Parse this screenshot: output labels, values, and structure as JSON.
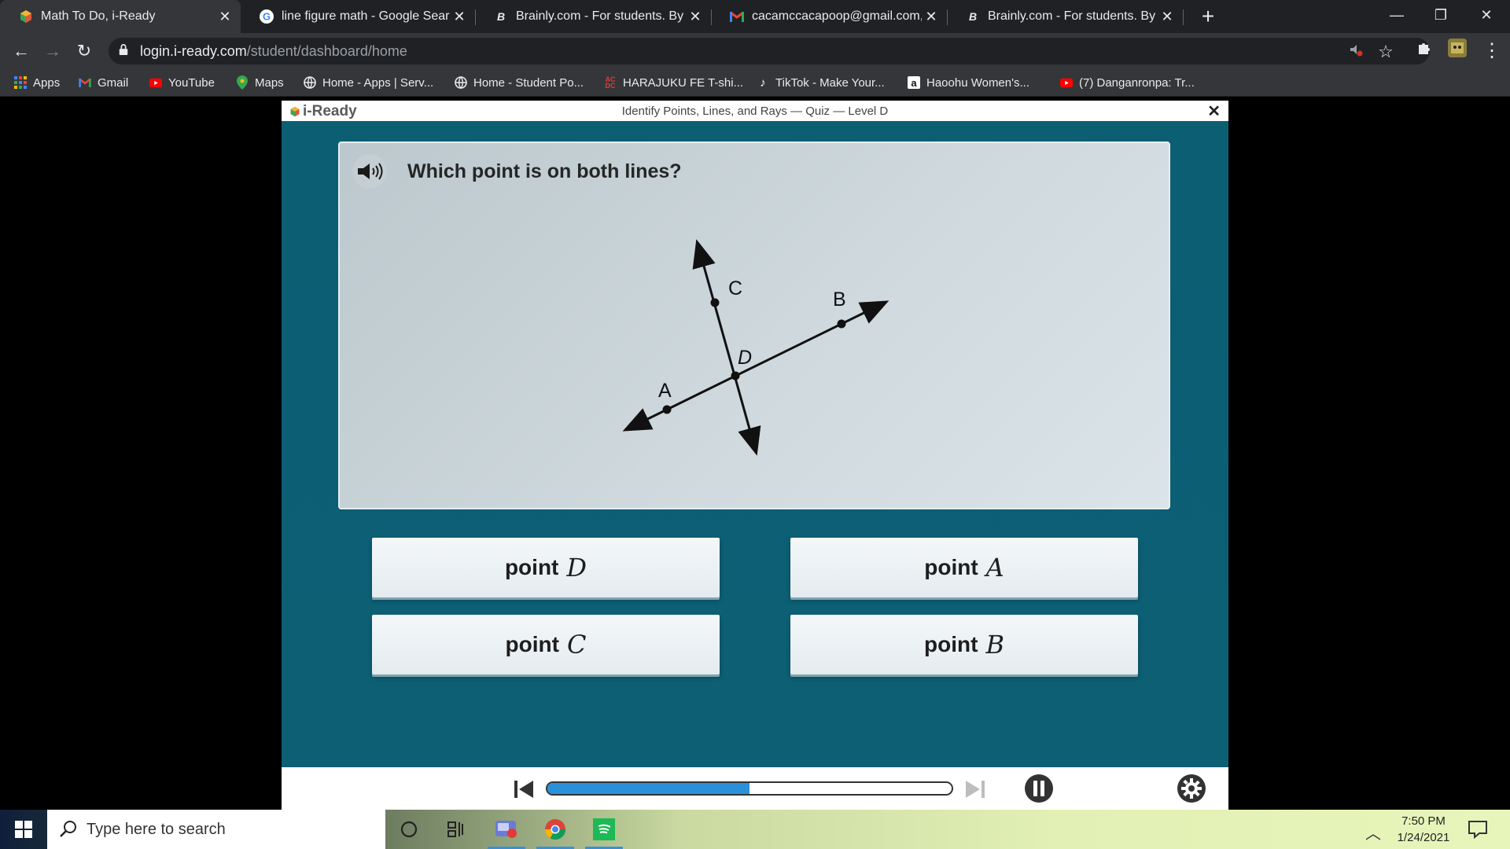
{
  "browser": {
    "tabs": [
      {
        "title": "Math To Do, i-Ready",
        "icon": "iready-icon",
        "active": true
      },
      {
        "title": "line figure math - Google Search",
        "icon": "google-icon",
        "active": false
      },
      {
        "title": "Brainly.com - For students. By stu",
        "icon": "brainly-icon",
        "active": false
      },
      {
        "title": "cacamccacapoop@gmail.com, co",
        "icon": "gmail-icon",
        "active": false
      },
      {
        "title": "Brainly.com - For students. By stu",
        "icon": "brainly-icon",
        "active": false
      }
    ],
    "url_host": "login.i-ready.com",
    "url_path": "/student/dashboard/home",
    "bookmarks": [
      {
        "label": "Apps",
        "icon": "apps-grid-icon"
      },
      {
        "label": "Gmail",
        "icon": "gmail-icon"
      },
      {
        "label": "YouTube",
        "icon": "youtube-icon"
      },
      {
        "label": "Maps",
        "icon": "maps-icon"
      },
      {
        "label": "Home - Apps | Serv...",
        "icon": "globe-icon"
      },
      {
        "label": "Home - Student Po...",
        "icon": "globe-icon"
      },
      {
        "label": "HARAJUKU FE T-shi...",
        "icon": "acdc-icon"
      },
      {
        "label": "TikTok - Make Your...",
        "icon": "tiktok-icon"
      },
      {
        "label": "Haoohu Women's...",
        "icon": "amazon-icon"
      },
      {
        "label": "(7) Danganronpa: Tr...",
        "icon": "youtube-icon"
      }
    ]
  },
  "iready": {
    "logo_text": "i-Ready",
    "lesson_title": "Identify Points, Lines, and Rays — Quiz — Level D",
    "question": "Which point is on both lines?",
    "figure_labels": {
      "a": "A",
      "b": "B",
      "c": "C",
      "d": "D"
    },
    "answers": [
      {
        "word": "point",
        "var": "D"
      },
      {
        "word": "point",
        "var": "A"
      },
      {
        "word": "point",
        "var": "C"
      },
      {
        "word": "point",
        "var": "B"
      }
    ],
    "progress_fraction": 0.5
  },
  "taskbar": {
    "search_placeholder": "Type here to search",
    "time": "7:50 PM",
    "date": "1/24/2021"
  }
}
